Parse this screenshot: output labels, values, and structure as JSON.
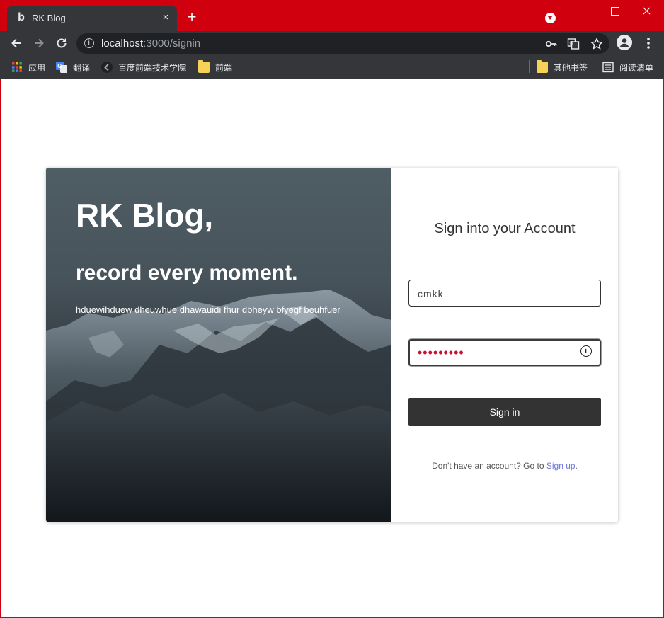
{
  "browser": {
    "tab": {
      "favicon": "b",
      "title": "RK Blog",
      "close_label": "×"
    },
    "new_tab_label": "+",
    "url": {
      "host": "localhost",
      "rest": ":3000/signin"
    },
    "bookmarks": [
      {
        "label": "应用",
        "icon": "apps-grid-icon"
      },
      {
        "label": "翻译",
        "icon": "google-translate-icon"
      },
      {
        "label": "百度前端技术学院",
        "icon": "leaf-icon"
      },
      {
        "label": "前端",
        "icon": "folder-icon"
      }
    ],
    "bookmarks_right": [
      {
        "label": "其他书签",
        "icon": "folder-icon"
      },
      {
        "label": "阅读清单",
        "icon": "reading-list-icon"
      }
    ]
  },
  "hero": {
    "title": "RK Blog,",
    "subtitle": "record every moment.",
    "description": "hduewihduew dheuwhue dhawauidi fhur dbheyw bfyegf beuhfuer"
  },
  "form": {
    "title": "Sign into your Account",
    "username_value": "cmkk",
    "password_masked": "•••••••••",
    "signin_label": "Sign in",
    "signup_prefix": "Don't have an account? Go to ",
    "signup_link": "Sign up",
    "signup_suffix": "."
  },
  "colors": {
    "frame": "#d0000f",
    "button": "#333333",
    "link": "#6b78d8",
    "password_dots": "#c8102e"
  }
}
